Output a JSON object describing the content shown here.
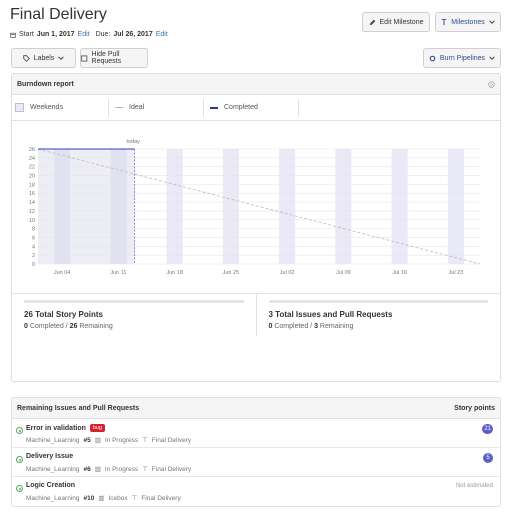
{
  "header": {
    "title": "Final Delivery",
    "start_label": "Start",
    "start_date": "Jun 1, 2017",
    "edit1": "Edit",
    "due_label": "Due:",
    "due_date": "Jul 26, 2017",
    "edit2": "Edit"
  },
  "toolbar": {
    "edit_milestone": "Edit Milestone",
    "milestones": "Milestones",
    "labels": "Labels",
    "hide_prs": "Hide Pull Requests",
    "burn_pipelines": "Burn Pipelines"
  },
  "burndown": {
    "title": "Burndown report",
    "legend_weekends": "Weekends",
    "legend_ideal": "Ideal",
    "legend_completed": "Completed",
    "today_label": "today"
  },
  "chart_data": {
    "type": "line",
    "title": "Burndown report",
    "y_ticks": [
      0,
      2,
      4,
      6,
      8,
      10,
      12,
      14,
      16,
      18,
      20,
      22,
      24,
      26
    ],
    "ylim": [
      0,
      26
    ],
    "x_labels": [
      "Jun 04",
      "Jun 11",
      "Jun 18",
      "Jun 25",
      "Jul 02",
      "Jul 09",
      "Jul 16",
      "Jul 23"
    ],
    "x_range": [
      "Jun 1, 2017",
      "Jul 26, 2017"
    ],
    "today": "Jun 13, 2017",
    "series": [
      {
        "name": "Ideal",
        "points": [
          [
            "Jun 1, 2017",
            26
          ],
          [
            "Jul 26, 2017",
            0
          ]
        ]
      },
      {
        "name": "Completed",
        "points": [
          [
            "Jun 1, 2017",
            26
          ],
          [
            "Jun 13, 2017",
            26
          ]
        ]
      }
    ],
    "colors": {
      "weekend": "#e9e9f7",
      "elapsed": "#d6d6ec",
      "ideal": "#bbbbbb",
      "completed": "#5b5fc7"
    }
  },
  "stats": {
    "points_title": "26 Total Story Points",
    "points_completed": "0",
    "points_completed_label": "Completed /",
    "points_remaining": "26",
    "points_remaining_label": "Remaining",
    "issues_title": "3 Total Issues and Pull Requests",
    "issues_completed": "0",
    "issues_completed_label": "Completed /",
    "issues_remaining": "3",
    "issues_remaining_label": "Remaining"
  },
  "remaining": {
    "title": "Remaining Issues and Pull Requests",
    "points_header": "Story points",
    "issues": [
      {
        "title": "Error in validation",
        "label": "bug",
        "repo": "Machine_Learning",
        "number": "#5",
        "pipeline": "In Progress",
        "milestone": "Final Delivery",
        "points": "21"
      },
      {
        "title": "Delivery Issue",
        "repo": "Machine_Learning",
        "number": "#6",
        "pipeline": "In Progress",
        "milestone": "Final Delivery",
        "points": "5"
      },
      {
        "title": "Logic Creation",
        "repo": "Machine_Learning",
        "number": "#10",
        "pipeline": "Icebox",
        "milestone": "Final Delivery",
        "points": "Not estimated"
      }
    ]
  }
}
